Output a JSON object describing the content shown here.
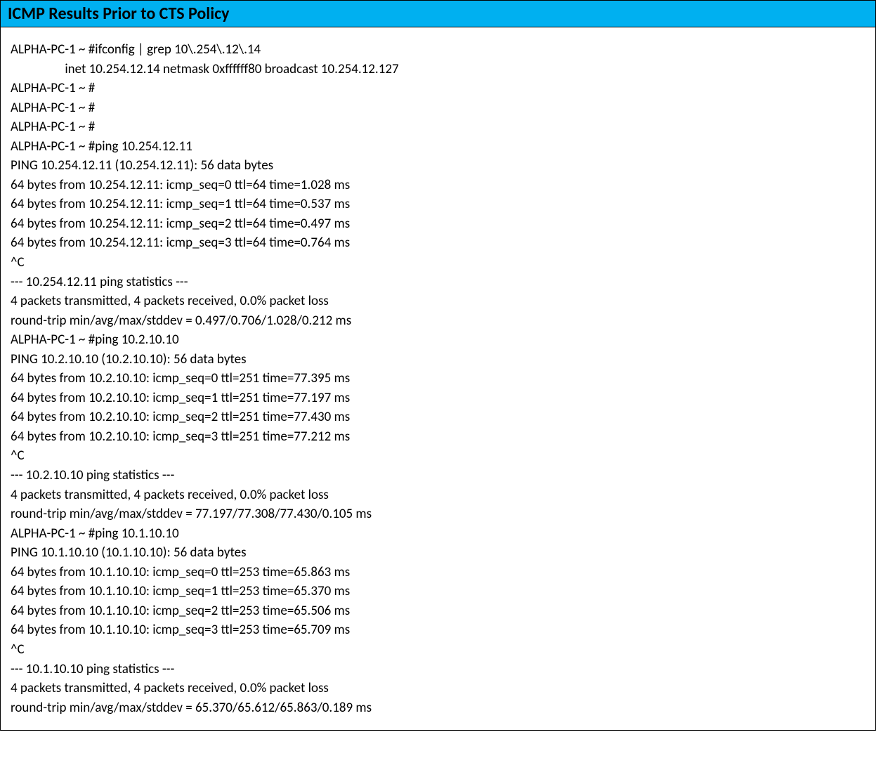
{
  "header": {
    "title": "ICMP Results Prior to CTS Policy"
  },
  "terminal": {
    "lines": [
      "ALPHA-PC-1 ~ #ifconfig | grep 10\\.254\\.12\\.14",
      "                  inet 10.254.12.14 netmask 0xffffff80 broadcast 10.254.12.127",
      "ALPHA-PC-1 ~ #",
      "ALPHA-PC-1 ~ #",
      "ALPHA-PC-1 ~ #",
      "ALPHA-PC-1 ~ #ping 10.254.12.11",
      "PING 10.254.12.11 (10.254.12.11): 56 data bytes",
      "64 bytes from 10.254.12.11: icmp_seq=0 ttl=64 time=1.028 ms",
      "64 bytes from 10.254.12.11: icmp_seq=1 ttl=64 time=0.537 ms",
      "64 bytes from 10.254.12.11: icmp_seq=2 ttl=64 time=0.497 ms",
      "64 bytes from 10.254.12.11: icmp_seq=3 ttl=64 time=0.764 ms",
      "^C",
      "--- 10.254.12.11 ping statistics ---",
      "4 packets transmitted, 4 packets received, 0.0% packet loss",
      "round-trip min/avg/max/stddev = 0.497/0.706/1.028/0.212 ms",
      "ALPHA-PC-1 ~ #ping 10.2.10.10",
      "PING 10.2.10.10 (10.2.10.10): 56 data bytes",
      "64 bytes from 10.2.10.10: icmp_seq=0 ttl=251 time=77.395 ms",
      "64 bytes from 10.2.10.10: icmp_seq=1 ttl=251 time=77.197 ms",
      "64 bytes from 10.2.10.10: icmp_seq=2 ttl=251 time=77.430 ms",
      "64 bytes from 10.2.10.10: icmp_seq=3 ttl=251 time=77.212 ms",
      "^C",
      "--- 10.2.10.10 ping statistics ---",
      "4 packets transmitted, 4 packets received, 0.0% packet loss",
      "round-trip min/avg/max/stddev = 77.197/77.308/77.430/0.105 ms",
      "ALPHA-PC-1 ~ #ping 10.1.10.10",
      "PING 10.1.10.10 (10.1.10.10): 56 data bytes",
      "64 bytes from 10.1.10.10: icmp_seq=0 ttl=253 time=65.863 ms",
      "64 bytes from 10.1.10.10: icmp_seq=1 ttl=253 time=65.370 ms",
      "64 bytes from 10.1.10.10: icmp_seq=2 ttl=253 time=65.506 ms",
      "64 bytes from 10.1.10.10: icmp_seq=3 ttl=253 time=65.709 ms",
      "^C",
      "--- 10.1.10.10 ping statistics ---",
      "4 packets transmitted, 4 packets received, 0.0% packet loss",
      "round-trip min/avg/max/stddev = 65.370/65.612/65.863/0.189 ms"
    ]
  }
}
